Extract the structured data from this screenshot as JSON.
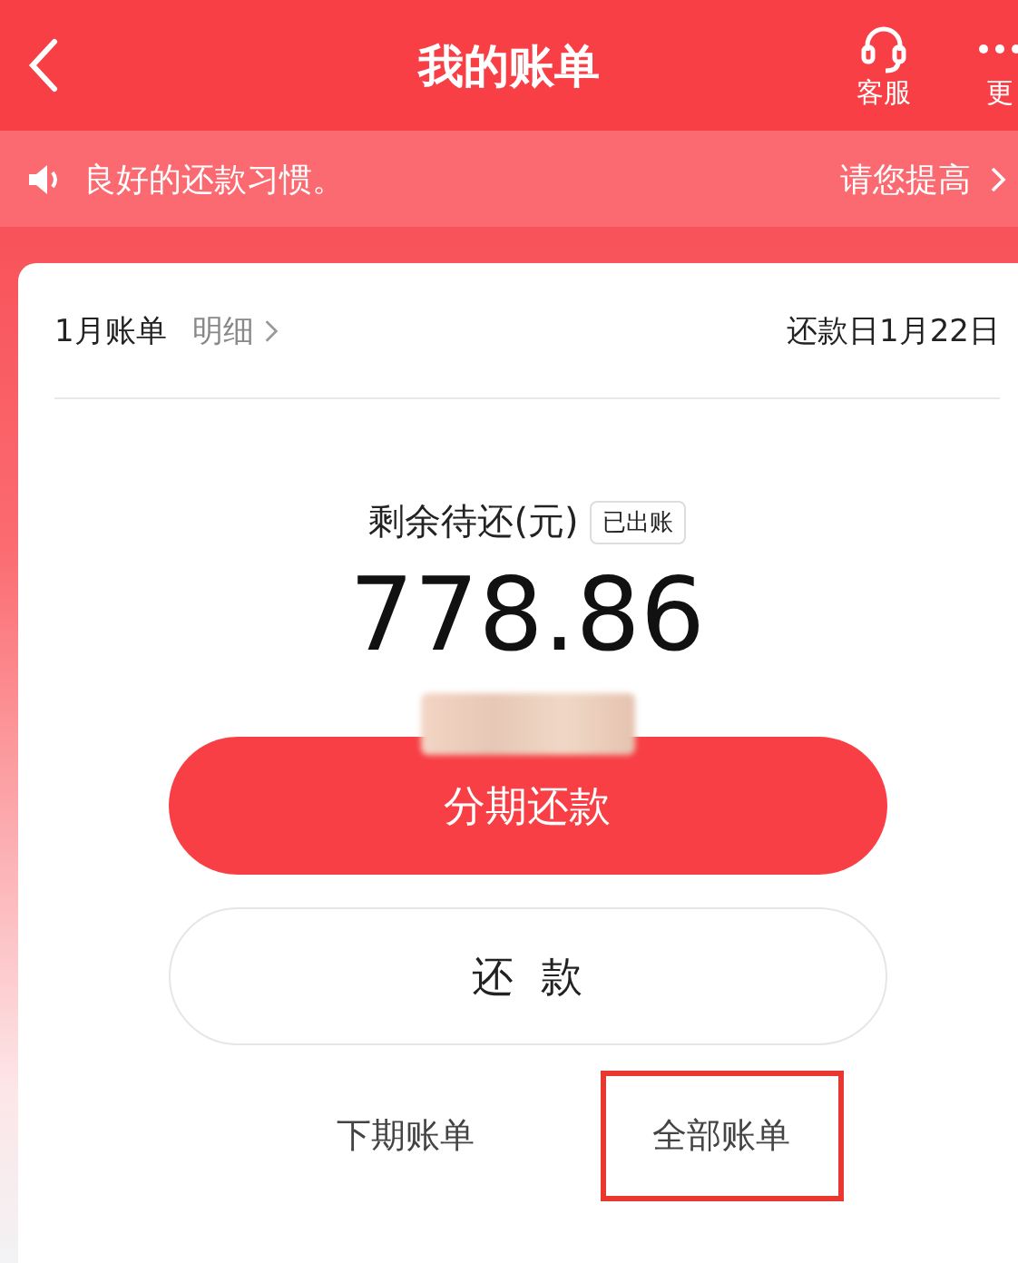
{
  "header": {
    "title": "我的账单",
    "actions": [
      {
        "kind": "headset",
        "label": "客服"
      },
      {
        "kind": "more",
        "label": "更"
      }
    ]
  },
  "notice": {
    "left": "良好的还款习惯。",
    "right": "请您提高"
  },
  "bill": {
    "month": "1月账单",
    "detail_link": "明细",
    "due_date": "还款日1月22日",
    "remaining_label": "剩余待还(元)",
    "status_tag": "已出账",
    "amount": "778.86"
  },
  "buttons": [
    {
      "kind": "primary",
      "label": "分期还款"
    },
    {
      "kind": "secondary",
      "label": "还  款"
    }
  ],
  "links": [
    {
      "label": "下期账单",
      "highlighted": false
    },
    {
      "label": "全部账单",
      "highlighted": true
    }
  ]
}
